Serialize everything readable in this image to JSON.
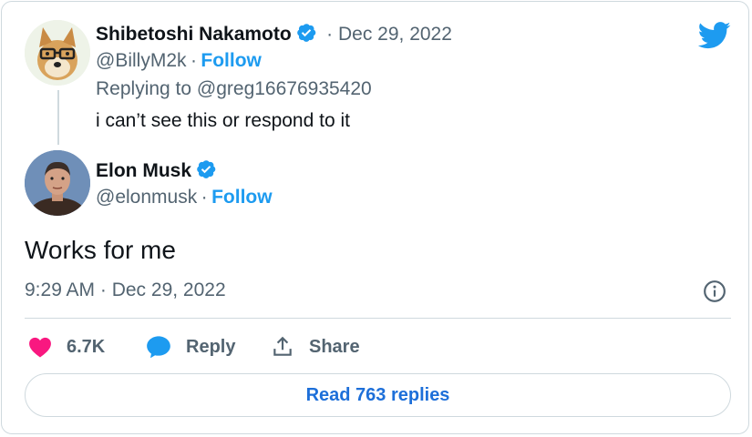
{
  "reply_tweet": {
    "author_name": "Shibetoshi Nakamoto",
    "date": "· Dec 29, 2022",
    "handle": "@BillyM2k",
    "follow_separator": "·",
    "follow_label": "Follow",
    "replying_to": "Replying to @greg16676935420",
    "text": "i can’t see this or respond to it"
  },
  "main_tweet": {
    "author_name": "Elon Musk",
    "handle": "@elonmusk",
    "follow_separator": "·",
    "follow_label": "Follow",
    "text": "Works for me",
    "timestamp": "9:29 AM · Dec 29, 2022"
  },
  "actions": {
    "likes": "6.7K",
    "reply_label": "Reply",
    "share_label": "Share"
  },
  "read_replies_label": "Read 763 replies",
  "colors": {
    "accent": "#1d9bf0",
    "like": "#f91880",
    "text_muted": "#536471",
    "border": "#cfd9de"
  },
  "icons": [
    "twitter-bird-icon",
    "verified-badge-icon",
    "info-icon",
    "heart-icon",
    "reply-bubble-icon",
    "share-icon"
  ]
}
